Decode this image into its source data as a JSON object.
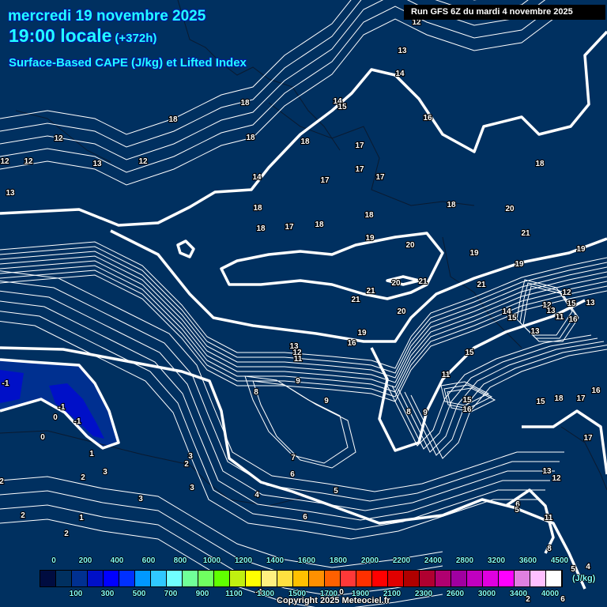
{
  "header": {
    "date": "mercredi 19 novembre 2025",
    "time": "19:00 locale",
    "lead": "(+372h)",
    "title": "Surface-Based CAPE (J/kg) et Lifted Index",
    "run": "Run GFS 6Z du mardi 4 novembre 2025"
  },
  "legend": {
    "unit": "(J/kg)",
    "top_labels": [
      "0",
      "200",
      "400",
      "600",
      "800",
      "1000",
      "1200",
      "1400",
      "1600",
      "1800",
      "2000",
      "2200",
      "2400",
      "2800",
      "3200",
      "3600",
      "4500"
    ],
    "bottom_labels": [
      "100",
      "300",
      "500",
      "700",
      "900",
      "1100",
      "1300",
      "1500",
      "1700",
      "1900",
      "2100",
      "2300",
      "2600",
      "3000",
      "3400",
      "4000"
    ],
    "colors": [
      "#000c40",
      "#003060",
      "#003090",
      "#0010c8",
      "#0000ff",
      "#0030ff",
      "#0098ff",
      "#30c8ff",
      "#70ffff",
      "#70ff98",
      "#70ff60",
      "#60ff00",
      "#c0f010",
      "#ffff00",
      "#fff080",
      "#ffe040",
      "#ffc000",
      "#ff9000",
      "#ff6000",
      "#ff3838",
      "#ff3000",
      "#ff0000",
      "#e00000",
      "#b00000",
      "#b00030",
      "#b00070",
      "#a000a0",
      "#c000c0",
      "#e000e0",
      "#ff00ff",
      "#e080e0",
      "#ffc0ff",
      "#ffffff"
    ]
  },
  "lifted_index_labels": [
    "12",
    "12",
    "12",
    "13",
    "12",
    "13",
    "18",
    "18",
    "18",
    "18",
    "17",
    "17",
    "17",
    "17",
    "14",
    "18",
    "18",
    "17",
    "18",
    "18",
    "19",
    "20",
    "18",
    "20",
    "21",
    "18",
    "16",
    "13",
    "14",
    "12",
    "14",
    "15",
    "19",
    "19",
    "19",
    "21",
    "21",
    "20",
    "21",
    "21",
    "20",
    "19",
    "16",
    "13",
    "12",
    "11",
    "8",
    "9",
    "9",
    "9",
    "8",
    "11",
    "15",
    "15",
    "16",
    "14",
    "15",
    "13",
    "12",
    "12",
    "13",
    "15",
    "11",
    "16",
    "13",
    "15",
    "18",
    "17",
    "16",
    "17",
    "13",
    "12",
    "6",
    "5",
    "11",
    "8",
    "5",
    "4",
    "6",
    "2",
    "5",
    "6",
    "7",
    "6",
    "4",
    "3",
    "2",
    "3",
    "3",
    "3",
    "2",
    "1",
    "1",
    "2",
    "2",
    "2",
    "0",
    "0",
    "-1",
    "-1",
    "-1",
    "0",
    "-1"
  ],
  "copyright": "Copyright 2025 Meteociel.fr",
  "colors": {
    "background": "#003060",
    "title": "#22ffff",
    "negative_li": "#0010c8"
  }
}
